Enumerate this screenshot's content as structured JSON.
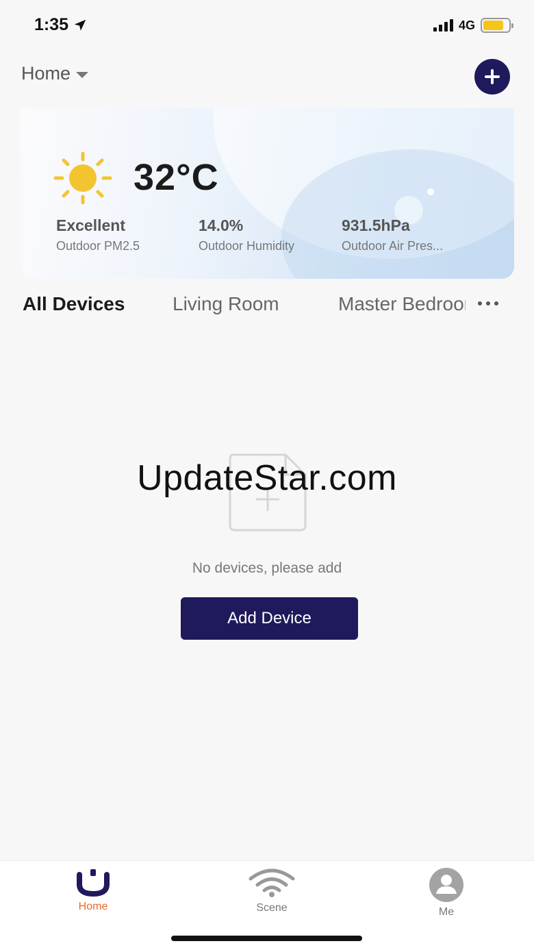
{
  "status_bar": {
    "time": "1:35",
    "network": "4G",
    "battery_color": "#f5c518",
    "location_icon": "location-arrow-icon"
  },
  "header": {
    "home_label": "Home",
    "add_icon": "plus-circle-icon"
  },
  "weather": {
    "icon": "sun-icon",
    "temperature": "32°C",
    "stats": [
      {
        "value": "Excellent",
        "label": "Outdoor PM2.5"
      },
      {
        "value": "14.0%",
        "label": "Outdoor Humidity"
      },
      {
        "value": "931.5hPa",
        "label": "Outdoor Air Pres..."
      }
    ]
  },
  "tabs": [
    {
      "label": "All Devices",
      "active": true
    },
    {
      "label": "Living Room",
      "active": false
    },
    {
      "label": "Master Bedroom",
      "active": false
    }
  ],
  "empty_state": {
    "icon": "add-file-icon",
    "watermark": "UpdateStar.com",
    "message": "No devices, please add",
    "button_label": "Add Device"
  },
  "bottom_nav": [
    {
      "label": "Home",
      "icon": "home-logo-icon",
      "active": true
    },
    {
      "label": "Scene",
      "icon": "wifi-icon",
      "active": false
    },
    {
      "label": "Me",
      "icon": "user-avatar-icon",
      "active": false
    }
  ],
  "colors": {
    "accent": "#1f1a5c",
    "active_nav_label": "#e8692c",
    "inactive": "#777777"
  }
}
